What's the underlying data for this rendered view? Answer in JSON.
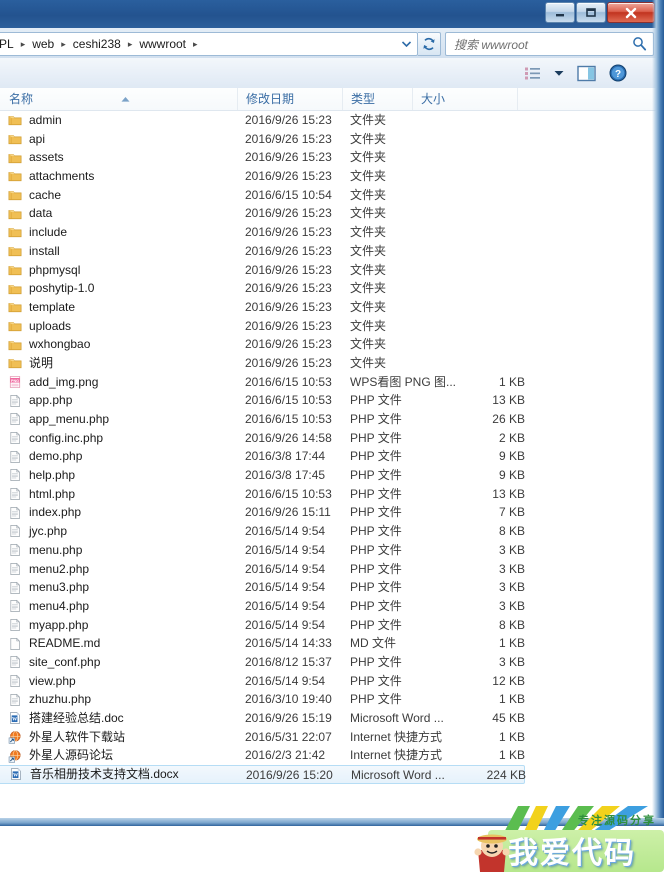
{
  "window": {
    "titlebar_buttons": [
      {
        "name": "minimize",
        "glyph": "minimize-icon"
      },
      {
        "name": "maximize",
        "glyph": "maximize-icon"
      },
      {
        "name": "close",
        "glyph": "close-icon"
      }
    ]
  },
  "address_bar": {
    "crumbs": [
      "PL",
      "web",
      "ceshi238",
      "wwwroot"
    ],
    "separator": "▸",
    "dropdown_icon": "chevron-down-icon",
    "refresh_icon": "refresh-icon"
  },
  "search": {
    "placeholder": "搜索 wwwroot",
    "icon": "search-icon"
  },
  "toolbar": {
    "view_icon": "view-options-icon",
    "view_dropdown_icon": "chevron-down-icon",
    "preview_pane_icon": "preview-pane-icon",
    "help_icon": "help-icon"
  },
  "columns": {
    "name": "名称",
    "date": "修改日期",
    "type": "类型",
    "size": "大小",
    "sort_indicator": "sort-ascending-icon"
  },
  "types": {
    "folder": "文件夹",
    "php": "PHP 文件",
    "png": "WPS看图 PNG 图...",
    "md": "MD 文件",
    "word": "Microsoft Word ...",
    "shortcut": "Internet 快捷方式"
  },
  "rows": [
    {
      "name": "admin",
      "date": "2016/9/26 15:23",
      "type": "文件夹",
      "size": "",
      "icon": "folder-icon",
      "selected": false
    },
    {
      "name": "api",
      "date": "2016/9/26 15:23",
      "type": "文件夹",
      "size": "",
      "icon": "folder-icon",
      "selected": false
    },
    {
      "name": "assets",
      "date": "2016/9/26 15:23",
      "type": "文件夹",
      "size": "",
      "icon": "folder-icon",
      "selected": false
    },
    {
      "name": "attachments",
      "date": "2016/9/26 15:23",
      "type": "文件夹",
      "size": "",
      "icon": "folder-icon",
      "selected": false
    },
    {
      "name": "cache",
      "date": "2016/6/15 10:54",
      "type": "文件夹",
      "size": "",
      "icon": "folder-icon",
      "selected": false
    },
    {
      "name": "data",
      "date": "2016/9/26 15:23",
      "type": "文件夹",
      "size": "",
      "icon": "folder-icon",
      "selected": false
    },
    {
      "name": "include",
      "date": "2016/9/26 15:23",
      "type": "文件夹",
      "size": "",
      "icon": "folder-icon",
      "selected": false
    },
    {
      "name": "install",
      "date": "2016/9/26 15:23",
      "type": "文件夹",
      "size": "",
      "icon": "folder-icon",
      "selected": false
    },
    {
      "name": "phpmysql",
      "date": "2016/9/26 15:23",
      "type": "文件夹",
      "size": "",
      "icon": "folder-icon",
      "selected": false
    },
    {
      "name": "poshytip-1.0",
      "date": "2016/9/26 15:23",
      "type": "文件夹",
      "size": "",
      "icon": "folder-icon",
      "selected": false
    },
    {
      "name": "template",
      "date": "2016/9/26 15:23",
      "type": "文件夹",
      "size": "",
      "icon": "folder-icon",
      "selected": false
    },
    {
      "name": "uploads",
      "date": "2016/9/26 15:23",
      "type": "文件夹",
      "size": "",
      "icon": "folder-icon",
      "selected": false
    },
    {
      "name": "wxhongbao",
      "date": "2016/9/26 15:23",
      "type": "文件夹",
      "size": "",
      "icon": "folder-icon",
      "selected": false
    },
    {
      "name": "说明",
      "date": "2016/9/26 15:23",
      "type": "文件夹",
      "size": "",
      "icon": "folder-icon",
      "selected": false
    },
    {
      "name": "add_img.png",
      "date": "2016/6/15 10:53",
      "type": "WPS看图 PNG 图...",
      "size": "1 KB",
      "icon": "png-file-icon",
      "selected": false
    },
    {
      "name": "app.php",
      "date": "2016/6/15 10:53",
      "type": "PHP 文件",
      "size": "13 KB",
      "icon": "php-file-icon",
      "selected": false
    },
    {
      "name": "app_menu.php",
      "date": "2016/6/15 10:53",
      "type": "PHP 文件",
      "size": "26 KB",
      "icon": "php-file-icon",
      "selected": false
    },
    {
      "name": "config.inc.php",
      "date": "2016/9/26 14:58",
      "type": "PHP 文件",
      "size": "2 KB",
      "icon": "php-file-icon",
      "selected": false
    },
    {
      "name": "demo.php",
      "date": "2016/3/8 17:44",
      "type": "PHP 文件",
      "size": "9 KB",
      "icon": "php-file-icon",
      "selected": false
    },
    {
      "name": "help.php",
      "date": "2016/3/8 17:45",
      "type": "PHP 文件",
      "size": "9 KB",
      "icon": "php-file-icon",
      "selected": false
    },
    {
      "name": "html.php",
      "date": "2016/6/15 10:53",
      "type": "PHP 文件",
      "size": "13 KB",
      "icon": "php-file-icon",
      "selected": false
    },
    {
      "name": "index.php",
      "date": "2016/9/26 15:11",
      "type": "PHP 文件",
      "size": "7 KB",
      "icon": "php-file-icon",
      "selected": false
    },
    {
      "name": "jyc.php",
      "date": "2016/5/14 9:54",
      "type": "PHP 文件",
      "size": "8 KB",
      "icon": "php-file-icon",
      "selected": false
    },
    {
      "name": "menu.php",
      "date": "2016/5/14 9:54",
      "type": "PHP 文件",
      "size": "3 KB",
      "icon": "php-file-icon",
      "selected": false
    },
    {
      "name": "menu2.php",
      "date": "2016/5/14 9:54",
      "type": "PHP 文件",
      "size": "3 KB",
      "icon": "php-file-icon",
      "selected": false
    },
    {
      "name": "menu3.php",
      "date": "2016/5/14 9:54",
      "type": "PHP 文件",
      "size": "3 KB",
      "icon": "php-file-icon",
      "selected": false
    },
    {
      "name": "menu4.php",
      "date": "2016/5/14 9:54",
      "type": "PHP 文件",
      "size": "3 KB",
      "icon": "php-file-icon",
      "selected": false
    },
    {
      "name": "myapp.php",
      "date": "2016/5/14 9:54",
      "type": "PHP 文件",
      "size": "8 KB",
      "icon": "php-file-icon",
      "selected": false
    },
    {
      "name": "README.md",
      "date": "2016/5/14 14:33",
      "type": "MD 文件",
      "size": "1 KB",
      "icon": "md-file-icon",
      "selected": false
    },
    {
      "name": "site_conf.php",
      "date": "2016/8/12 15:37",
      "type": "PHP 文件",
      "size": "3 KB",
      "icon": "php-file-icon",
      "selected": false
    },
    {
      "name": "view.php",
      "date": "2016/5/14 9:54",
      "type": "PHP 文件",
      "size": "12 KB",
      "icon": "php-file-icon",
      "selected": false
    },
    {
      "name": "zhuzhu.php",
      "date": "2016/3/10 19:40",
      "type": "PHP 文件",
      "size": "1 KB",
      "icon": "php-file-icon",
      "selected": false
    },
    {
      "name": "搭建经验总结.doc",
      "date": "2016/9/26 15:19",
      "type": "Microsoft Word ...",
      "size": "45 KB",
      "icon": "word-file-icon",
      "selected": false
    },
    {
      "name": "外星人软件下载站",
      "date": "2016/5/31 22:07",
      "type": "Internet 快捷方式",
      "size": "1 KB",
      "icon": "internet-shortcut-icon",
      "selected": false
    },
    {
      "name": "外星人源码论坛",
      "date": "2016/2/3 21:42",
      "type": "Internet 快捷方式",
      "size": "1 KB",
      "icon": "internet-shortcut-icon",
      "selected": false
    },
    {
      "name": "音乐相册技术支持文档.docx",
      "date": "2016/9/26 15:20",
      "type": "Microsoft Word ...",
      "size": "224 KB",
      "icon": "word-file-icon",
      "selected": true
    }
  ],
  "watermark": {
    "title": "我爱代码",
    "subtitle": "专注源码分享"
  },
  "colors": {
    "titlebar": "#23538f",
    "close_button": "#c1331f",
    "column_header_text": "#3b6ea5",
    "selection": "#e6f2fb",
    "folder_icon": "#f2c25a"
  }
}
